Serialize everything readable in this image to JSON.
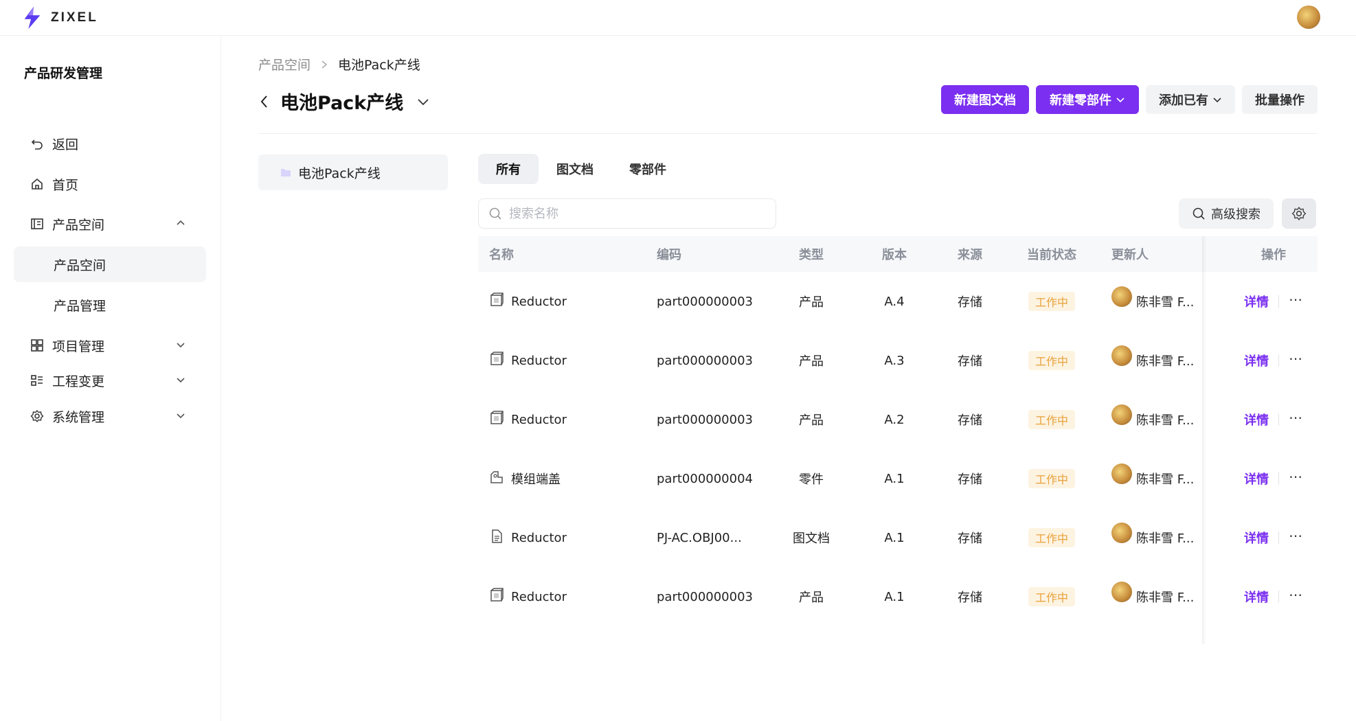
{
  "app": {
    "logo_text": "ZIXEL"
  },
  "sidebar": {
    "title": "产品研发管理",
    "items": [
      {
        "label": "返回",
        "icon": "undo-icon"
      },
      {
        "label": "首页",
        "icon": "home-icon"
      },
      {
        "label": "产品空间",
        "icon": "product-space-icon",
        "expanded": true
      },
      {
        "label": "产品空间",
        "sub": true,
        "active": true
      },
      {
        "label": "产品管理",
        "sub": true
      },
      {
        "label": "项目管理",
        "icon": "project-icon"
      },
      {
        "label": "工程变更",
        "icon": "change-icon"
      },
      {
        "label": "系统管理",
        "icon": "settings-icon"
      }
    ]
  },
  "breadcrumb": {
    "parent": "产品空间",
    "current": "电池Pack产线"
  },
  "page": {
    "title": "电池Pack产线"
  },
  "actions": {
    "new_doc": "新建图文档",
    "new_part": "新建零部件",
    "add_existing": "添加已有",
    "batch": "批量操作"
  },
  "tree": {
    "node": "电池Pack产线"
  },
  "tabs": [
    "所有",
    "图文档",
    "零部件"
  ],
  "search": {
    "placeholder": "搜索名称",
    "advanced": "高级搜索"
  },
  "table": {
    "columns": [
      "名称",
      "编码",
      "类型",
      "版本",
      "来源",
      "当前状态",
      "更新人",
      "操作"
    ],
    "rows": [
      {
        "name": "Reductor",
        "icon": "product-box-icon",
        "code": "part000000003",
        "type": "产品",
        "version": "A.4",
        "source": "存储",
        "status": "工作中",
        "user": "陈非雪 F...",
        "op": "详情"
      },
      {
        "name": "Reductor",
        "icon": "product-box-icon",
        "code": "part000000003",
        "type": "产品",
        "version": "A.3",
        "source": "存储",
        "status": "工作中",
        "user": "陈非雪 F...",
        "op": "详情"
      },
      {
        "name": "Reductor",
        "icon": "product-box-icon",
        "code": "part000000003",
        "type": "产品",
        "version": "A.2",
        "source": "存储",
        "status": "工作中",
        "user": "陈非雪 F...",
        "op": "详情"
      },
      {
        "name": "模组端盖",
        "icon": "part-icon",
        "code": "part000000004",
        "type": "零件",
        "version": "A.1",
        "source": "存储",
        "status": "工作中",
        "user": "陈非雪 F...",
        "op": "详情"
      },
      {
        "name": "Reductor",
        "icon": "document-icon",
        "code": "PJ-AC.OBJ00...",
        "type": "图文档",
        "version": "A.1",
        "source": "存储",
        "status": "工作中",
        "user": "陈非雪 F...",
        "op": "详情"
      },
      {
        "name": "Reductor",
        "icon": "product-box-icon",
        "code": "part000000003",
        "type": "产品",
        "version": "A.1",
        "source": "存储",
        "status": "工作中",
        "user": "陈非雪 F...",
        "op": "详情"
      }
    ]
  },
  "colors": {
    "primary": "#7b2ff0",
    "status": "#e8a23a"
  }
}
